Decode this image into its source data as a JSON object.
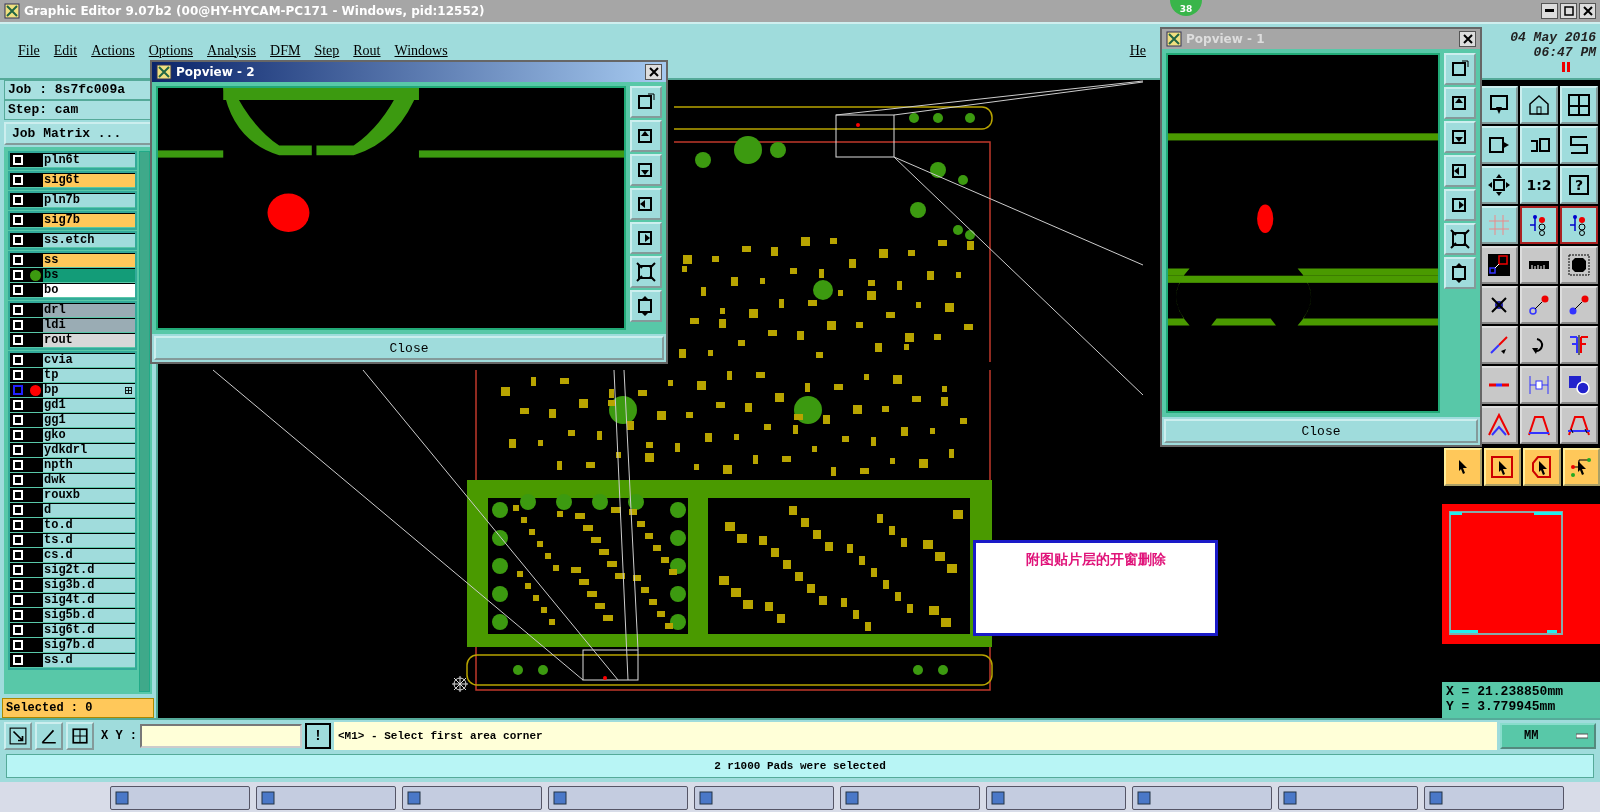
{
  "window": {
    "title": "Graphic Editor 9.07b2 (00@HY-HYCAM-PC171 - Windows, pid:12552)",
    "badge": "38"
  },
  "menu": [
    "File",
    "Edit",
    "Actions",
    "Options",
    "Analysis",
    "DFM",
    "Step",
    "Rout",
    "Windows",
    "He"
  ],
  "clock": {
    "date": "04 May 2016",
    "time": "06:47 PM"
  },
  "job_panel": {
    "job": "Job : 8s7fc009a",
    "step": "Step: cam",
    "matrix_button": "Job Matrix ...",
    "selected": "Selected : 0"
  },
  "layer_groups": [
    [
      {
        "name": "pln6t",
        "kind": "board",
        "current": false
      }
    ],
    [
      {
        "name": "sig6t",
        "kind": "signal",
        "current": false
      }
    ],
    [
      {
        "name": "pln7b",
        "kind": "board",
        "current": false
      }
    ],
    [
      {
        "name": "sig7b",
        "kind": "signal",
        "current": false
      }
    ],
    [
      {
        "name": "ss.etch",
        "kind": "board",
        "current": false
      }
    ],
    [
      {
        "name": "ss",
        "kind": "signal",
        "current": false
      },
      {
        "name": "bs",
        "kind": "mask",
        "color": "#3c9a10",
        "current": false
      },
      {
        "name": "bo",
        "kind": "outline",
        "current": false
      }
    ],
    [
      {
        "name": "drl",
        "kind": "drill",
        "current": false
      },
      {
        "name": "ldi",
        "kind": "drill",
        "current": false
      },
      {
        "name": "rout",
        "kind": "rout",
        "current": false
      }
    ],
    [
      {
        "name": "cvia",
        "kind": "board",
        "current": false
      },
      {
        "name": "tp",
        "kind": "board",
        "current": false
      },
      {
        "name": "bp",
        "kind": "board",
        "color": "#ff0000",
        "current": true
      },
      {
        "name": "gd1",
        "kind": "board",
        "current": false
      },
      {
        "name": "gg1",
        "kind": "board",
        "current": false
      },
      {
        "name": "gko",
        "kind": "board",
        "current": false
      },
      {
        "name": "ydkdrl",
        "kind": "board",
        "current": false
      },
      {
        "name": "npth",
        "kind": "board",
        "current": false
      },
      {
        "name": "dwk",
        "kind": "board",
        "current": false
      },
      {
        "name": "rouxb",
        "kind": "board",
        "current": false
      },
      {
        "name": "d",
        "kind": "board",
        "current": false
      },
      {
        "name": "to.d",
        "kind": "board",
        "current": false
      },
      {
        "name": "ts.d",
        "kind": "board",
        "current": false
      },
      {
        "name": "cs.d",
        "kind": "board",
        "current": false
      },
      {
        "name": "sig2t.d",
        "kind": "board",
        "current": false
      },
      {
        "name": "sig3b.d",
        "kind": "board",
        "current": false
      },
      {
        "name": "sig4t.d",
        "kind": "board",
        "current": false
      },
      {
        "name": "sig5b.d",
        "kind": "board",
        "current": false
      },
      {
        "name": "sig6t.d",
        "kind": "board",
        "current": false
      },
      {
        "name": "sig7b.d",
        "kind": "board",
        "current": false
      },
      {
        "name": "ss.d",
        "kind": "board",
        "current": false
      }
    ]
  ],
  "popviews": [
    {
      "title": "Popview - 2",
      "kind": "bottom",
      "active": true,
      "close": "Close"
    },
    {
      "title": "Popview - 1",
      "kind": "top",
      "active": false,
      "close": "Close"
    }
  ],
  "toolbar": {
    "ratio_label": "1:2",
    "help_label": "?"
  },
  "note": "附图贴片层的开窗删除",
  "coordinates": {
    "x": "X = 21.238850mm",
    "y": "Y = 3.779945mm"
  },
  "command": {
    "xy_label": "X Y :",
    "alert": "!",
    "prompt": "<M1> - Select first area corner",
    "units": "MM"
  },
  "status": "2 r1000 Pads were selected"
}
